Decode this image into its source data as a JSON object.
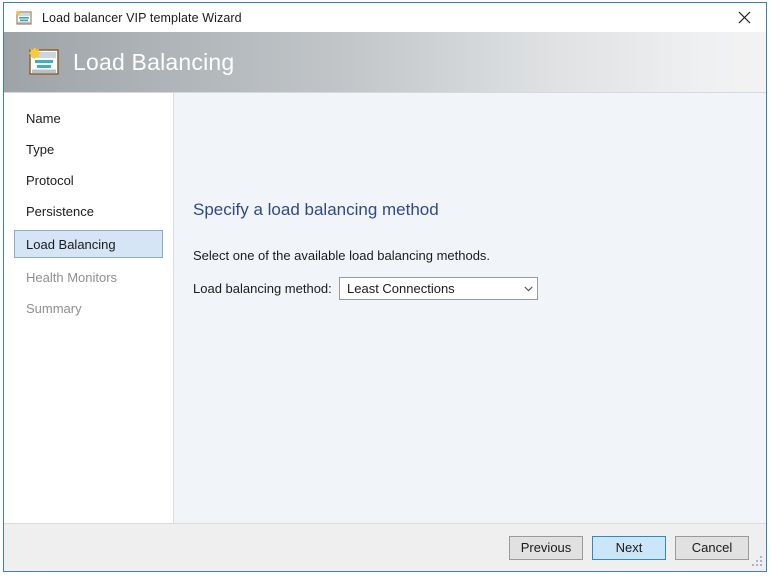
{
  "window": {
    "title": "Load balancer VIP template Wizard",
    "title_icon": "load-balancer-icon",
    "close_label": "✕",
    "border_color": "#3a85ad"
  },
  "header": {
    "title": "Load Balancing",
    "icon": "load-balancer-banner-icon",
    "text_color": "#ffffff"
  },
  "sidebar": {
    "items": [
      {
        "label": "Name",
        "state": "done"
      },
      {
        "label": "Type",
        "state": "done"
      },
      {
        "label": "Protocol",
        "state": "done"
      },
      {
        "label": "Persistence",
        "state": "done"
      },
      {
        "label": "Load Balancing",
        "state": "selected"
      },
      {
        "label": "Health Monitors",
        "state": "disabled"
      },
      {
        "label": "Summary",
        "state": "disabled"
      }
    ],
    "selected_bg": "#d5e5f5",
    "selected_border": "#8badcd"
  },
  "main": {
    "heading": "Specify a load balancing method",
    "heading_color": "#2f4b84",
    "description": "Select one of the available load balancing methods.",
    "field": {
      "label": "Load balancing method:",
      "value": "Least Connections",
      "arrow_icon": "chevron-down-icon"
    }
  },
  "footer": {
    "previous_label": "Previous",
    "next_label": "Next",
    "cancel_label": "Cancel",
    "primary_bg": "#cbe6f8",
    "primary_border": "#2f8bc4"
  }
}
